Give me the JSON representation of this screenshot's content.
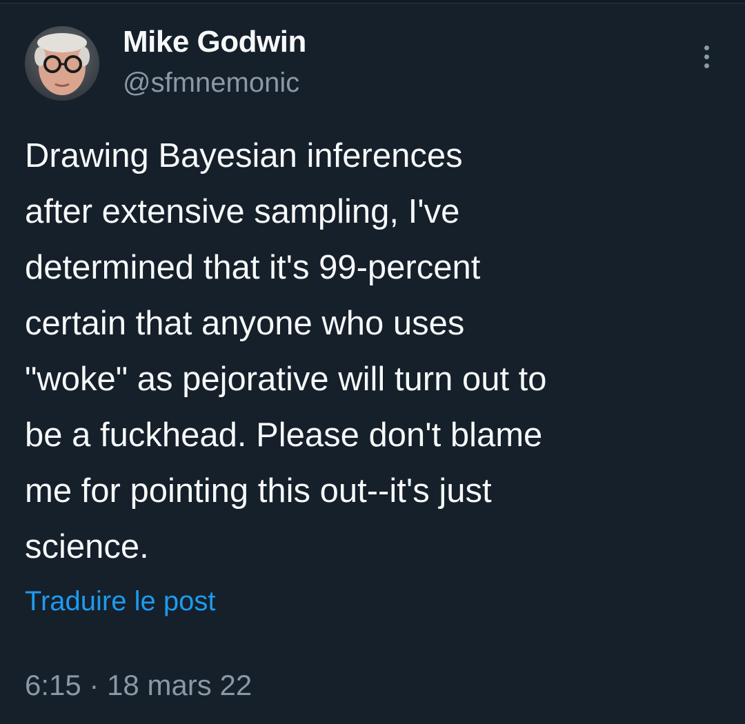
{
  "author": {
    "name": "Mike Godwin",
    "handle": "@sfmnemonic",
    "avatar_icon": "profile-photo-avatar"
  },
  "menu": {
    "icon": "more-options-icon"
  },
  "tweet": {
    "text": "Drawing Bayesian inferences\nafter extensive sampling, I've\ndetermined that it's 99-percent\ncertain that anyone who uses\n\"woke\" as pejorative will turn out to\nbe a fuckhead. Please don't blame\nme for pointing this out--it's just\nscience.",
    "translate_label": "Traduire le post",
    "timestamp": "6:15 · 18 mars 22"
  },
  "colors": {
    "background": "#15202b",
    "text_primary": "#f7f9f9",
    "text_secondary": "#8b98a5",
    "link": "#1d9bf0"
  }
}
